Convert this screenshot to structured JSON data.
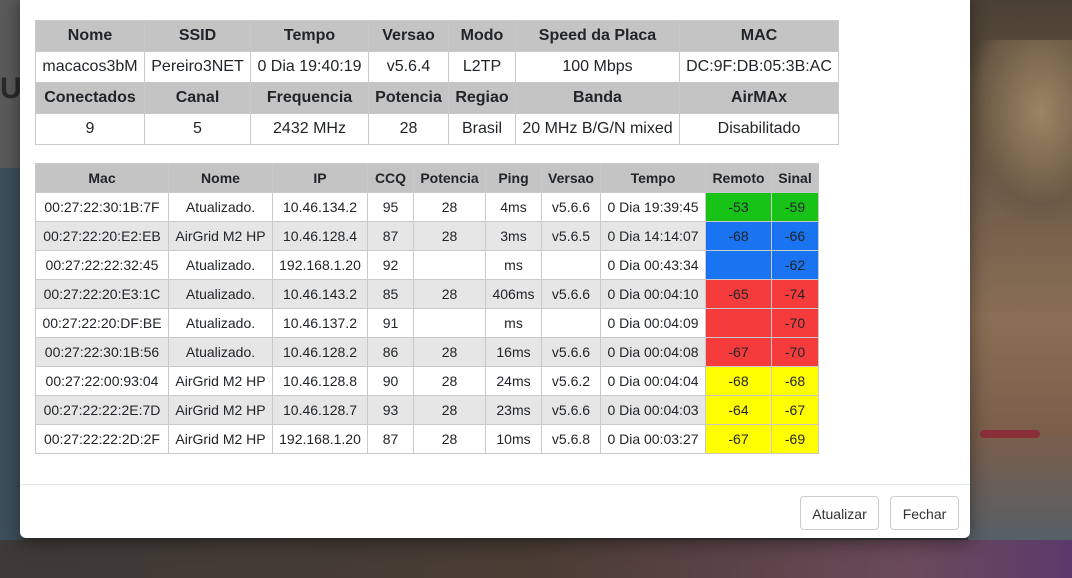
{
  "colors": {
    "green": "#18c318",
    "blue": "#1a73f0",
    "red": "#f53b3b",
    "yellow": "#ffff00"
  },
  "info": {
    "headers1": [
      "Nome",
      "SSID",
      "Tempo",
      "Versao",
      "Modo",
      "Speed da Placa",
      "MAC"
    ],
    "values1": [
      "macacos3bM",
      "Pereiro3NET",
      "0 Dia 19:40:19",
      "v5.6.4",
      "L2TP",
      "100 Mbps",
      "DC:9F:DB:05:3B:AC"
    ],
    "headers2": [
      "Conectados",
      "Canal",
      "Frequencia",
      "Potencia",
      "Regiao",
      "Banda",
      "AirMAx"
    ],
    "values2": [
      "9",
      "5",
      "2432 MHz",
      "28",
      "Brasil",
      "20 MHz B/G/N mixed",
      "Disabilitado"
    ]
  },
  "clients": {
    "headers": [
      "Mac",
      "Nome",
      "IP",
      "CCQ",
      "Potencia",
      "Ping",
      "Versao",
      "Tempo",
      "Remoto",
      "Sinal"
    ],
    "rows": [
      {
        "mac": "00:27:22:30:1B:7F",
        "nome": "Atualizado.",
        "ip": "10.46.134.2",
        "ccq": "95",
        "potencia": "28",
        "ping": "4ms",
        "versao": "v5.6.6",
        "tempo": "0 Dia 19:39:45",
        "remoto": "-53",
        "sinal": "-59",
        "remoto_color": "green",
        "sinal_color": "green"
      },
      {
        "mac": "00:27:22:20:E2:EB",
        "nome": "AirGrid M2 HP",
        "ip": "10.46.128.4",
        "ccq": "87",
        "potencia": "28",
        "ping": "3ms",
        "versao": "v5.6.5",
        "tempo": "0 Dia 14:14:07",
        "remoto": "-68",
        "sinal": "-66",
        "remoto_color": "blue",
        "sinal_color": "blue"
      },
      {
        "mac": "00:27:22:22:32:45",
        "nome": "Atualizado.",
        "ip": "192.168.1.20",
        "ccq": "92",
        "potencia": "",
        "ping": "ms",
        "versao": "",
        "tempo": "0 Dia 00:43:34",
        "remoto": "",
        "sinal": "-62",
        "remoto_color": "blue",
        "sinal_color": "blue"
      },
      {
        "mac": "00:27:22:20:E3:1C",
        "nome": "Atualizado.",
        "ip": "10.46.143.2",
        "ccq": "85",
        "potencia": "28",
        "ping": "406ms",
        "versao": "v5.6.6",
        "tempo": "0 Dia 00:04:10",
        "remoto": "-65",
        "sinal": "-74",
        "remoto_color": "red",
        "sinal_color": "red"
      },
      {
        "mac": "00:27:22:20:DF:BE",
        "nome": "Atualizado.",
        "ip": "10.46.137.2",
        "ccq": "91",
        "potencia": "",
        "ping": "ms",
        "versao": "",
        "tempo": "0 Dia 00:04:09",
        "remoto": "",
        "sinal": "-70",
        "remoto_color": "red",
        "sinal_color": "red"
      },
      {
        "mac": "00:27:22:30:1B:56",
        "nome": "Atualizado.",
        "ip": "10.46.128.2",
        "ccq": "86",
        "potencia": "28",
        "ping": "16ms",
        "versao": "v5.6.6",
        "tempo": "0 Dia 00:04:08",
        "remoto": "-67",
        "sinal": "-70",
        "remoto_color": "red",
        "sinal_color": "red"
      },
      {
        "mac": "00:27:22:00:93:04",
        "nome": "AirGrid M2 HP",
        "ip": "10.46.128.8",
        "ccq": "90",
        "potencia": "28",
        "ping": "24ms",
        "versao": "v5.6.2",
        "tempo": "0 Dia 00:04:04",
        "remoto": "-68",
        "sinal": "-68",
        "remoto_color": "yellow",
        "sinal_color": "yellow"
      },
      {
        "mac": "00:27:22:22:2E:7D",
        "nome": "AirGrid M2 HP",
        "ip": "10.46.128.7",
        "ccq": "93",
        "potencia": "28",
        "ping": "23ms",
        "versao": "v5.6.6",
        "tempo": "0 Dia 00:04:03",
        "remoto": "-64",
        "sinal": "-67",
        "remoto_color": "yellow",
        "sinal_color": "yellow"
      },
      {
        "mac": "00:27:22:22:2D:2F",
        "nome": "AirGrid M2 HP",
        "ip": "192.168.1.20",
        "ccq": "87",
        "potencia": "28",
        "ping": "10ms",
        "versao": "v5.6.8",
        "tempo": "0 Dia 00:03:27",
        "remoto": "-67",
        "sinal": "-69",
        "remoto_color": "yellow",
        "sinal_color": "yellow"
      }
    ]
  },
  "footer": {
    "update_label": "Atualizar",
    "close_label": "Fechar"
  }
}
